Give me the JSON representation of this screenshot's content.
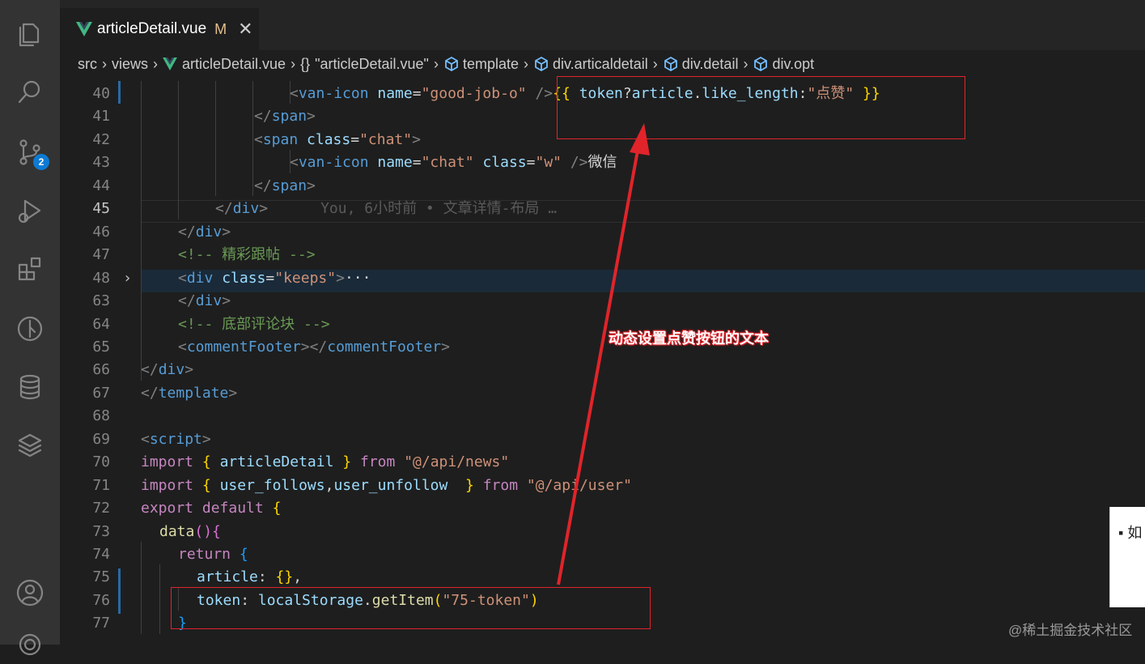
{
  "activity_bar": {
    "items": [
      {
        "name": "explorer",
        "icon": "files-icon"
      },
      {
        "name": "search",
        "icon": "search-icon"
      },
      {
        "name": "source-control",
        "icon": "source-control-icon",
        "badge": "2"
      },
      {
        "name": "run-debug",
        "icon": "run-debug-icon"
      },
      {
        "name": "extensions",
        "icon": "extensions-icon"
      },
      {
        "name": "git-graph",
        "icon": "git-graph-icon"
      },
      {
        "name": "database",
        "icon": "database-icon"
      },
      {
        "name": "layers",
        "icon": "layers-icon"
      },
      {
        "name": "accounts",
        "icon": "account-icon"
      },
      {
        "name": "manage",
        "icon": "gear-icon"
      }
    ],
    "badge_color": "#0e7ad3"
  },
  "tab": {
    "title": "articleDetail.vue",
    "modified": "M",
    "close": "✕"
  },
  "breadcrumb": {
    "src": "src",
    "views": "views",
    "file": "articleDetail.vue",
    "braces": "{}",
    "obj": "\"articleDetail.vue\"",
    "template": "template",
    "div1": "div.articaldetail",
    "div2": "div.detail",
    "div3": "div.opt"
  },
  "editor": {
    "lines": [
      {
        "no": "40",
        "code": [
          [
            "t-tag",
            "<"
          ],
          [
            "t-name",
            "van-icon"
          ],
          [
            "t-attr",
            " name"
          ],
          [
            "t-txt",
            "="
          ],
          [
            "t-str",
            "\"good-job-o\""
          ],
          [
            "t-txt",
            " "
          ],
          [
            "t-tag",
            "/>"
          ],
          [
            "t-br",
            "{{"
          ],
          [
            "t-txt",
            " "
          ],
          [
            "t-var",
            "token"
          ],
          [
            "t-txt",
            "?"
          ],
          [
            "t-var",
            "article"
          ],
          [
            "t-txt",
            "."
          ],
          [
            "t-var",
            "like_length"
          ],
          [
            "t-txt",
            ":"
          ],
          [
            "t-str",
            "\"点赞\""
          ],
          [
            "t-txt",
            " "
          ],
          [
            "t-br",
            "}}"
          ]
        ]
      },
      {
        "no": "41",
        "code": [
          [
            "t-tag",
            "</"
          ],
          [
            "t-name",
            "span"
          ],
          [
            "t-tag",
            ">"
          ]
        ]
      },
      {
        "no": "42",
        "code": [
          [
            "t-tag",
            "<"
          ],
          [
            "t-name",
            "span"
          ],
          [
            "t-attr",
            " class"
          ],
          [
            "t-txt",
            "="
          ],
          [
            "t-str",
            "\"chat\""
          ],
          [
            "t-tag",
            ">"
          ]
        ]
      },
      {
        "no": "43",
        "code": [
          [
            "t-tag",
            "<"
          ],
          [
            "t-name",
            "van-icon"
          ],
          [
            "t-attr",
            " name"
          ],
          [
            "t-txt",
            "="
          ],
          [
            "t-str",
            "\"chat\""
          ],
          [
            "t-attr",
            " class"
          ],
          [
            "t-txt",
            "="
          ],
          [
            "t-str",
            "\"w\""
          ],
          [
            "t-txt",
            " "
          ],
          [
            "t-tag",
            "/>"
          ],
          [
            "t-txt",
            "微信"
          ]
        ]
      },
      {
        "no": "44",
        "code": [
          [
            "t-tag",
            "</"
          ],
          [
            "t-name",
            "span"
          ],
          [
            "t-tag",
            ">"
          ]
        ]
      },
      {
        "no": "45",
        "code": [
          [
            "t-tag",
            "</"
          ],
          [
            "t-name",
            "div"
          ],
          [
            "t-tag",
            ">"
          ],
          [
            "t-blame",
            "      You, 6小时前 • 文章详情-布局 …"
          ]
        ]
      },
      {
        "no": "46",
        "code": [
          [
            "t-tag",
            "</"
          ],
          [
            "t-name",
            "div"
          ],
          [
            "t-tag",
            ">"
          ]
        ]
      },
      {
        "no": "47",
        "code": [
          [
            "t-cmt",
            "<!-- 精彩跟帖 -->"
          ]
        ]
      },
      {
        "no": "48",
        "code": [
          [
            "t-tag",
            "<"
          ],
          [
            "t-name",
            "div"
          ],
          [
            "t-attr",
            " class"
          ],
          [
            "t-txt",
            "="
          ],
          [
            "t-str",
            "\"keeps\""
          ],
          [
            "t-tag",
            ">"
          ],
          [
            "t-txt",
            "···"
          ]
        ]
      },
      {
        "no": "63",
        "code": [
          [
            "t-tag",
            "</"
          ],
          [
            "t-name",
            "div"
          ],
          [
            "t-tag",
            ">"
          ]
        ]
      },
      {
        "no": "64",
        "code": [
          [
            "t-cmt",
            "<!-- 底部评论块 -->"
          ]
        ]
      },
      {
        "no": "65",
        "code": [
          [
            "t-tag",
            "<"
          ],
          [
            "t-name",
            "commentFooter"
          ],
          [
            "t-tag",
            "></"
          ],
          [
            "t-name",
            "commentFooter"
          ],
          [
            "t-tag",
            ">"
          ]
        ]
      },
      {
        "no": "66",
        "code": [
          [
            "t-tag",
            "</"
          ],
          [
            "t-name",
            "div"
          ],
          [
            "t-tag",
            ">"
          ]
        ]
      },
      {
        "no": "67",
        "code": [
          [
            "t-tag",
            "</"
          ],
          [
            "t-name",
            "template"
          ],
          [
            "t-tag",
            ">"
          ]
        ]
      },
      {
        "no": "68",
        "code": []
      },
      {
        "no": "69",
        "code": [
          [
            "t-tag",
            "<"
          ],
          [
            "t-name",
            "script"
          ],
          [
            "t-tag",
            ">"
          ]
        ]
      },
      {
        "no": "70",
        "code": [
          [
            "t-kw",
            "import"
          ],
          [
            "t-txt",
            " "
          ],
          [
            "t-br",
            "{"
          ],
          [
            "t-txt",
            " "
          ],
          [
            "t-var",
            "articleDetail"
          ],
          [
            "t-txt",
            " "
          ],
          [
            "t-br",
            "}"
          ],
          [
            "t-txt",
            " "
          ],
          [
            "t-kw",
            "from"
          ],
          [
            "t-txt",
            " "
          ],
          [
            "t-str",
            "\"@/api/news\""
          ]
        ]
      },
      {
        "no": "71",
        "code": [
          [
            "t-kw",
            "import"
          ],
          [
            "t-txt",
            " "
          ],
          [
            "t-br",
            "{"
          ],
          [
            "t-txt",
            " "
          ],
          [
            "t-var",
            "user_follows"
          ],
          [
            "t-txt",
            ","
          ],
          [
            "t-var",
            "user_unfollow"
          ],
          [
            "t-txt",
            "  "
          ],
          [
            "t-br",
            "}"
          ],
          [
            "t-txt",
            " "
          ],
          [
            "t-kw",
            "from"
          ],
          [
            "t-txt",
            " "
          ],
          [
            "t-str",
            "\"@/api/user\""
          ]
        ]
      },
      {
        "no": "72",
        "code": [
          [
            "t-kw",
            "export"
          ],
          [
            "t-txt",
            " "
          ],
          [
            "t-kw",
            "default"
          ],
          [
            "t-txt",
            " "
          ],
          [
            "t-br",
            "{"
          ]
        ]
      },
      {
        "no": "73",
        "code": [
          [
            "t-fn",
            "data"
          ],
          [
            "t-br2",
            "()"
          ],
          [
            "t-br2",
            "{"
          ]
        ]
      },
      {
        "no": "74",
        "code": [
          [
            "t-kw",
            "return"
          ],
          [
            "t-txt",
            " "
          ],
          [
            "t-br3",
            "{"
          ]
        ]
      },
      {
        "no": "75",
        "code": [
          [
            "t-var",
            "article"
          ],
          [
            "t-txt",
            ": "
          ],
          [
            "t-br",
            "{}"
          ],
          [
            "t-txt",
            ","
          ]
        ]
      },
      {
        "no": "76",
        "code": [
          [
            "t-var",
            "token"
          ],
          [
            "t-txt",
            ": "
          ],
          [
            "t-var",
            "localStorage"
          ],
          [
            "t-txt",
            "."
          ],
          [
            "t-fn",
            "getItem"
          ],
          [
            "t-br",
            "("
          ],
          [
            "t-str",
            "\"75-token\""
          ],
          [
            "t-br",
            ")"
          ]
        ]
      },
      {
        "no": "77",
        "code": [
          [
            "t-br3",
            "}"
          ]
        ]
      }
    ],
    "current_line": "45"
  },
  "annotation": {
    "text": "动态设置点赞按钮的文本",
    "color": "#e0242a"
  },
  "popup": {
    "text": "▪ 如"
  },
  "watermark": "@稀土掘金技术社区"
}
